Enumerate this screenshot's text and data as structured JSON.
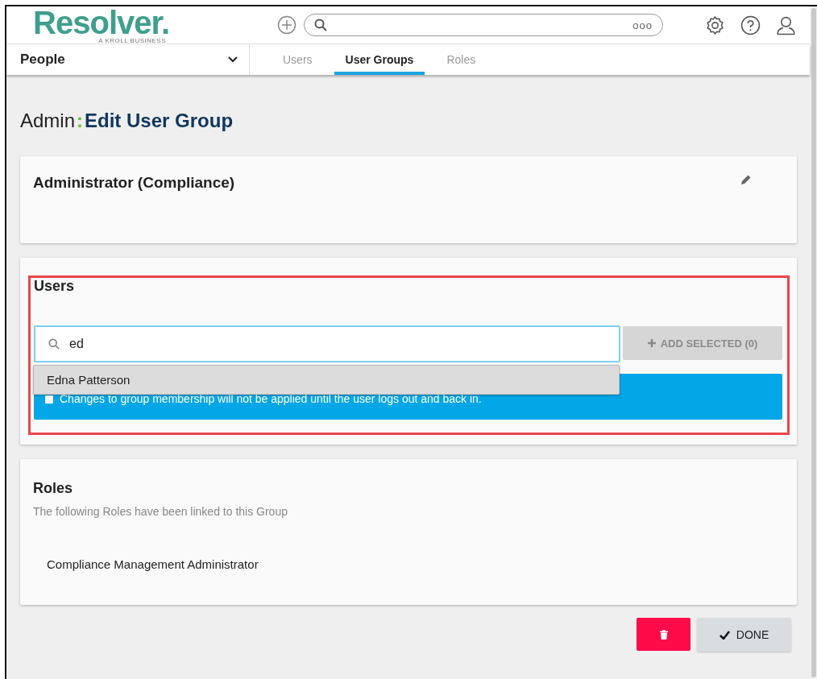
{
  "header": {
    "logo": "Resolver.",
    "logo_tagline": "A KROLL BUSINESS",
    "search_more": "ooo"
  },
  "nav": {
    "section": "People",
    "tabs": [
      {
        "label": "Users",
        "selected": false
      },
      {
        "label": "User Groups",
        "selected": true
      },
      {
        "label": "Roles",
        "selected": false
      }
    ]
  },
  "page_title": {
    "prefix": "Admin",
    "separator": ":",
    "title": "Edit User Group"
  },
  "group_card": {
    "name": "Administrator (Compliance)"
  },
  "users_card": {
    "title": "Users",
    "highlighted": true,
    "search": {
      "value": "ed"
    },
    "add_button": {
      "label": "ADD SELECTED (0)",
      "disabled": true
    },
    "notice": "Changes to group membership will not be applied until the user logs out and back in.",
    "suggestions": [
      "Edna Patterson"
    ]
  },
  "roles_card": {
    "title": "Roles",
    "description": "The following Roles have been linked to this Group",
    "roles": [
      "Compliance Management Administrator"
    ]
  },
  "actions": {
    "done": "DONE"
  }
}
